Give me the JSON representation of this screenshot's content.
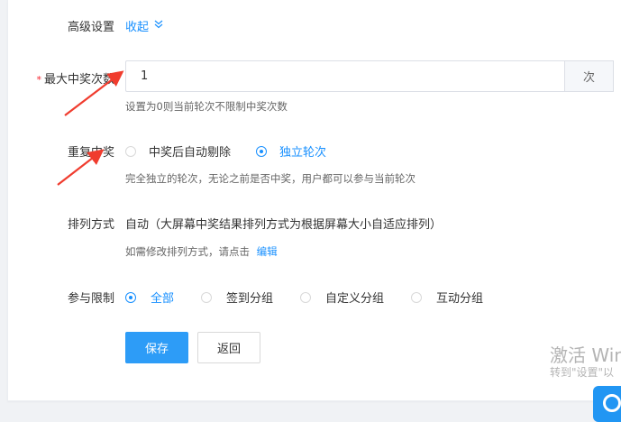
{
  "advanced": {
    "label": "高级设置",
    "toggle_label": "收起"
  },
  "max_wins": {
    "required_mark": "*",
    "label": "最大中奖次数",
    "value": "1",
    "unit": "次",
    "hint": "设置为0则当前轮次不限制中奖次数"
  },
  "repeat_win": {
    "label": "重复中奖",
    "options": [
      {
        "label": "中奖后自动剔除",
        "checked": false
      },
      {
        "label": "独立轮次",
        "checked": true
      }
    ],
    "hint": "完全独立的轮次，无论之前是否中奖，用户都可以参与当前轮次"
  },
  "arrange": {
    "label": "排列方式",
    "value": "自动（大屏幕中奖结果排列方式为根据屏幕大小自适应排列）",
    "hint_prefix": "如需修改排列方式，请点击",
    "hint_link": "编辑"
  },
  "limit": {
    "label": "参与限制",
    "options": [
      {
        "label": "全部",
        "checked": true
      },
      {
        "label": "签到分组",
        "checked": false
      },
      {
        "label": "自定义分组",
        "checked": false
      },
      {
        "label": "互动分组",
        "checked": false
      }
    ]
  },
  "actions": {
    "save": "保存",
    "back": "返回"
  },
  "watermark": {
    "line1": "激活 Win",
    "line2": "转到\"设置\"以"
  },
  "colors": {
    "accent": "#1890ff",
    "required": "#f5222d",
    "annotation_arrow": "#f03c2e"
  },
  "icons": {
    "toggle": "chevron-double-down-icon",
    "float": "float-action-icon"
  }
}
